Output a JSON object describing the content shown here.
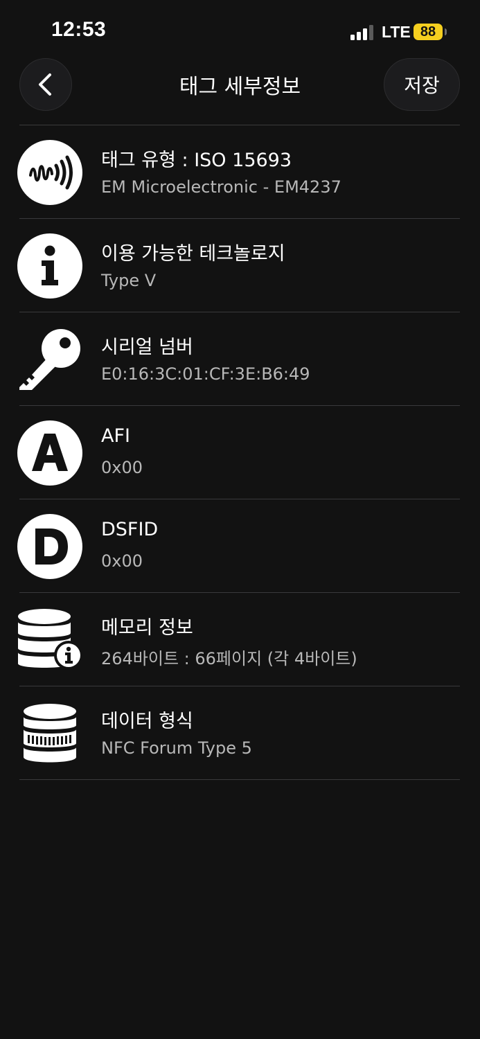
{
  "status": {
    "time": "12:53",
    "network": "LTE",
    "battery": "88"
  },
  "nav": {
    "title": "태그 세부정보",
    "save_label": "저장"
  },
  "rows": [
    {
      "icon": "nfc-wave-icon",
      "title": "태그 유형 : ISO 15693",
      "subtitle": "EM Microelectronic - EM4237"
    },
    {
      "icon": "info-icon",
      "title": "이용 가능한 테크놀로지",
      "subtitle": "Type V"
    },
    {
      "icon": "key-icon",
      "title": "시리얼 넘버",
      "subtitle": "E0:16:3C:01:CF:3E:B6:49"
    },
    {
      "icon": "letter-a-icon",
      "title": "AFI",
      "subtitle": "0x00"
    },
    {
      "icon": "letter-d-icon",
      "title": "DSFID",
      "subtitle": "0x00"
    },
    {
      "icon": "database-info-icon",
      "title": "메모리 정보",
      "subtitle": "264바이트 : 66페이지 (각 4바이트)"
    },
    {
      "icon": "database-format-icon",
      "title": "데이터 형식",
      "subtitle": "NFC Forum Type 5"
    }
  ]
}
